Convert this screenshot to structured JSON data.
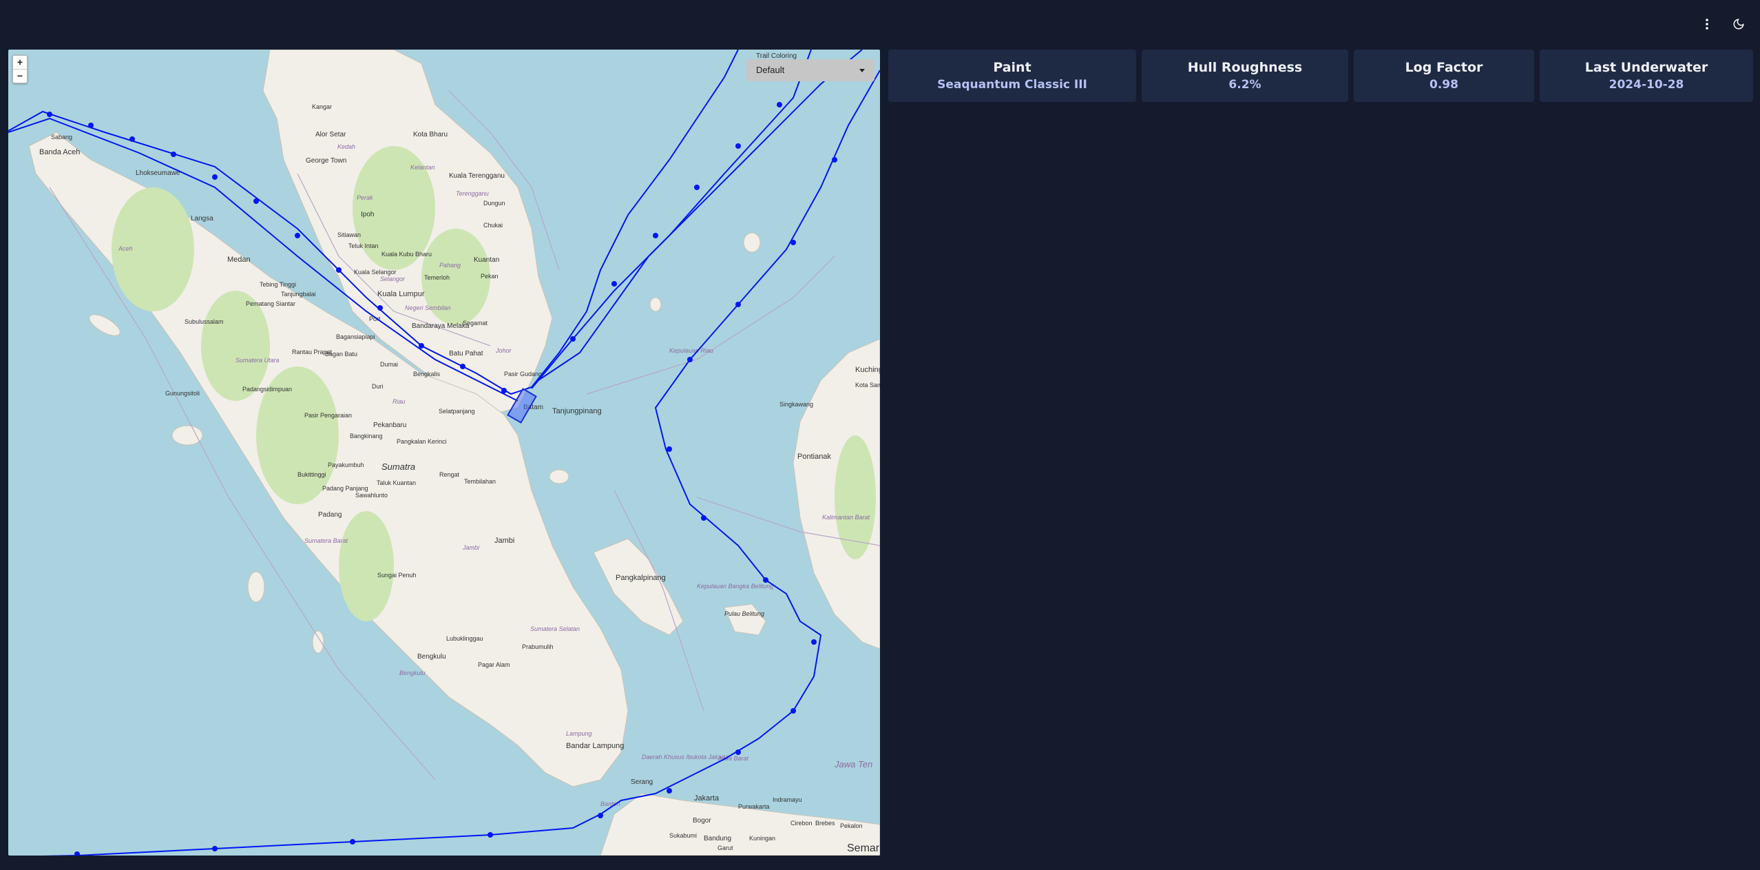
{
  "trail": {
    "label": "Trail Coloring",
    "selected": "Default"
  },
  "zoom": {
    "in": "+",
    "out": "−"
  },
  "icons": {
    "menu": "more-vertical-icon",
    "theme": "moon-icon"
  },
  "colors": {
    "background": "#141b2d",
    "card": "#1e2a44",
    "card_value": "#b7c1f2",
    "route": "#0016f5",
    "sea": "#aad3df",
    "land": "#f2efe9"
  },
  "cards": [
    {
      "title": "Paint",
      "value": "Seaquantum Classic III"
    },
    {
      "title": "Hull Roughness",
      "value": "6.2%"
    },
    {
      "title": "Log Factor",
      "value": "0.98"
    },
    {
      "title": "Last Underwater",
      "value": "2024-10-28"
    }
  ],
  "map_labels": {
    "banda_aceh": "Banda Aceh",
    "sabang": "Sabang",
    "lhokseumawe": "Lhokseumawe",
    "langsa": "Langsa",
    "medan": "Medan",
    "tebing_tinggi": "Tebing Tinggi",
    "pematang_siantar": "Pematang Siantar",
    "tanjungbalai": "Tanjungbalai",
    "sibolga": "Subulussalam",
    "gunungsitoli": "Gunungsitoli",
    "rantau_prapat": "Rantau Prapat",
    "bagan_batu": "Bagan Batu",
    "bagansiapiapi": "Bagansiapiapi",
    "dumai": "Dumai",
    "duri": "Duri",
    "bengkalis": "Bengkalis",
    "padangsidimpuan": "Padangsidimpuan",
    "pasir_pengaraian": "Pasir Pengaraian",
    "pekanbaru": "Pekanbaru",
    "bangkinang": "Bangkinang",
    "selatpanjang": "Selatpanjang",
    "payakumbuh": "Payakumbuh",
    "bukittinggi": "Bukittinggi",
    "padang_panjang": "Padang Panjang",
    "padang": "Padang",
    "sumatra": "Sumatra",
    "pangkalan_kerinci": "Pangkalan Kerinci",
    "rengat": "Rengat",
    "tembilahan": "Tembilahan",
    "taluk_kuantan": "Taluk Kuantan",
    "sawahlunto": "Sawahlunto",
    "jambi": "Jambi",
    "sungai_penuh": "Sungai Penuh",
    "bengkulu": "Bengkulu",
    "lubuklinggau": "Lubuklinggau",
    "prabumulih": "Prabumulih",
    "pagar_alam": "Pagar Alam",
    "pangkalpinang": "Pangkalpinang",
    "pulau_belitung": "Pulau Belitung",
    "bandar_lampung": "Bandar Lampung",
    "serang": "Serang",
    "jakarta": "Jakarta",
    "bogor": "Bogor",
    "bandung": "Bandung",
    "sukabumi": "Sukabumi",
    "purwakarta": "Purwakarta",
    "indramayu": "Indramayu",
    "cirebon": "Cirebon",
    "brebes": "Brebes",
    "pekalongan": "Pekalon",
    "kuningan": "Kuningan",
    "garut": "Garut",
    "semarang": "Semar",
    "jawa_tengah": "Jawa Ten",
    "alor_setar": "Alor Setar",
    "george_town": "George Town",
    "kangar": "Kangar",
    "kota_bharu": "Kota Bharu",
    "kuala_terengganu": "Kuala Terengganu",
    "dungun": "Dungun",
    "chukai": "Chukai",
    "ipoh": "Ipoh",
    "sitiawan": "Sitiawan",
    "teluk_intan": "Teluk Intan",
    "kuala_kubu_bharu": "Kuala Kubu Bharu",
    "kuala_selangor": "Kuala Selangor",
    "kuala_lumpur": "Kuala Lumpur",
    "port_dickson": "Port",
    "temerloh": "Temerloh",
    "kuantan": "Kuantan",
    "pekan": "Pekan",
    "segamat": "Segamat",
    "bandaraya_melaka": "Bandaraya Melaka",
    "batu_pahat": "Batu Pahat",
    "pasir_gudang": "Pasir Gudang",
    "batam": "Batam",
    "tanjungpinang": "Tanjungpinang",
    "pontianak": "Pontianak",
    "singkawang": "Singkawang",
    "kuching": "Kuching",
    "kota_samarahan": "Kota Sam",
    "kepulauan_riau": "Kepulauan Riau",
    "kalimantan_barat": "Kalimantan Barat",
    "kepulauan_belitung": "Kepulauan Bangka Belitung",
    "sumatera_selatan": "Sumatera Selatan",
    "lampung": "Lampung",
    "jawa_barat": "Jawa Barat",
    "dki_jakarta": "Daerah Khusus Ibukota Jakarta",
    "banten": "Banten",
    "aceh": "Aceh",
    "sumatera_barat": "Sumatera Barat",
    "riau": "Riau",
    "jambi_province": "Jambi",
    "bengkulu_province": "Bengkulu",
    "perak": "Perak",
    "kedah": "Kedah",
    "kelantan": "Kelantan",
    "terengganu": "Terengganu",
    "pahang": "Pahang",
    "selangor": "Selangor",
    "negeri_sembilan": "Negeri Sembilan",
    "johor": "Johor",
    "sumatera_utara": "Sumatera Utara"
  }
}
